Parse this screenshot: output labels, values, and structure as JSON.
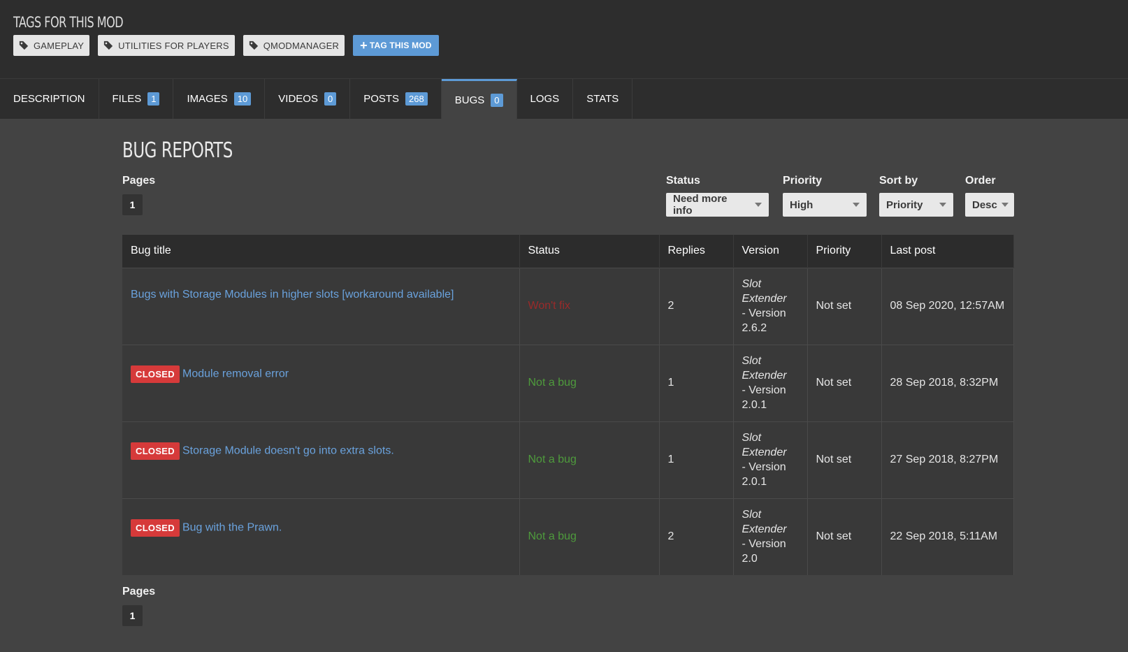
{
  "tags": {
    "title": "TAGS FOR THIS MOD",
    "items": [
      "GAMEPLAY",
      "UTILITIES FOR PLAYERS",
      "QMODMANAGER"
    ],
    "tag_this_label": "TAG THIS MOD"
  },
  "tabs": [
    {
      "label": "DESCRIPTION",
      "count": null
    },
    {
      "label": "FILES",
      "count": "1"
    },
    {
      "label": "IMAGES",
      "count": "10"
    },
    {
      "label": "VIDEOS",
      "count": "0"
    },
    {
      "label": "POSTS",
      "count": "268"
    },
    {
      "label": "BUGS",
      "count": "0"
    },
    {
      "label": "LOGS",
      "count": null
    },
    {
      "label": "STATS",
      "count": null
    }
  ],
  "active_tab": "BUGS",
  "main": {
    "title": "BUG REPORTS",
    "pages_label": "Pages",
    "page_number": "1",
    "filters": {
      "status": {
        "label": "Status",
        "value": "Need more info"
      },
      "priority": {
        "label": "Priority",
        "value": "High"
      },
      "sort_by": {
        "label": "Sort by",
        "value": "Priority"
      },
      "order": {
        "label": "Order",
        "value": "Desc"
      }
    },
    "table": {
      "headers": [
        "Bug title",
        "Status",
        "Replies",
        "Version",
        "Priority",
        "Last post"
      ],
      "rows": [
        {
          "closed": false,
          "title": "Bugs with Storage Modules in higher slots [workaround available]",
          "status": "Won't fix",
          "status_type": "wontfix",
          "replies": "2",
          "version_name": "Slot Extender",
          "version_line": "- Version 2.6.2",
          "priority": "Not set",
          "last_post": "08 Sep 2020, 12:57AM"
        },
        {
          "closed": true,
          "title": "Module removal error",
          "status": "Not a bug",
          "status_type": "notabug",
          "replies": "1",
          "version_name": "Slot Extender",
          "version_line": "- Version 2.0.1",
          "priority": "Not set",
          "last_post": "28 Sep 2018, 8:32PM"
        },
        {
          "closed": true,
          "title": "Storage Module doesn't go into extra slots.",
          "status": "Not a bug",
          "status_type": "notabug",
          "replies": "1",
          "version_name": "Slot Extender",
          "version_line": "- Version 2.0.1",
          "priority": "Not set",
          "last_post": "27 Sep 2018, 8:27PM"
        },
        {
          "closed": true,
          "title": "Bug with the Prawn.",
          "status": "Not a bug",
          "status_type": "notabug",
          "replies": "2",
          "version_name": "Slot Extender",
          "version_line": "- Version 2.0",
          "priority": "Not set",
          "last_post": "22 Sep 2018, 5:11AM"
        }
      ],
      "closed_badge": "CLOSED"
    }
  },
  "colors": {
    "accent": "#5d9ad6",
    "closed": "#d63a3a",
    "wontfix": "#9a2a2a",
    "notabug": "#4e9b3c"
  }
}
